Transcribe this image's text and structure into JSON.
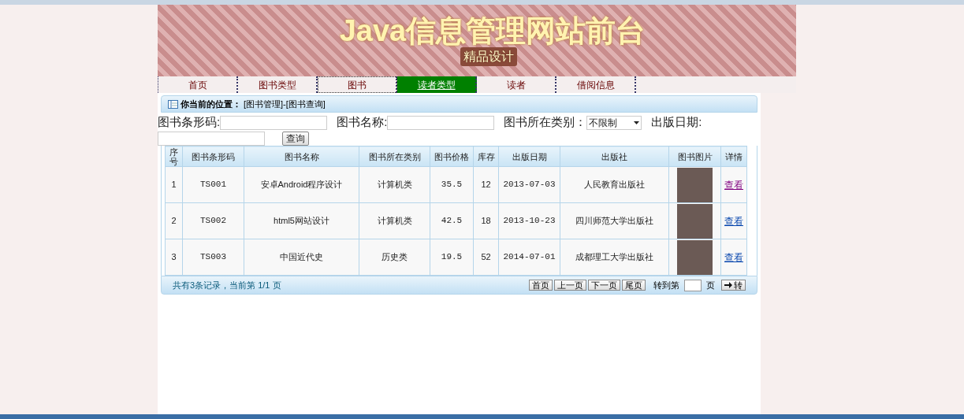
{
  "banner": {
    "title": "Java信息管理网站前台",
    "subtitle": "精品设计"
  },
  "nav": [
    {
      "label": "首页",
      "selected": false,
      "focused": false
    },
    {
      "label": "图书类型",
      "selected": false,
      "focused": false
    },
    {
      "label": "图书",
      "selected": false,
      "focused": true
    },
    {
      "label": "读者类型",
      "selected": true,
      "focused": false
    },
    {
      "label": "读者",
      "selected": false,
      "focused": false
    },
    {
      "label": "借阅信息",
      "selected": false,
      "focused": false
    }
  ],
  "breadcrumb": {
    "label": "你当前的位置：",
    "path": "[图书管理]-[图书查询]"
  },
  "search": {
    "fields": [
      {
        "kind": "input",
        "label": "图书条形码:"
      },
      {
        "kind": "input",
        "label": "图书名称:"
      },
      {
        "kind": "select",
        "label": "图书所在类别：",
        "value": "不限制"
      },
      {
        "kind": "input",
        "label": "出版日期:"
      }
    ],
    "button": "查询"
  },
  "table": {
    "columns": [
      "序号",
      "图书条形码",
      "图书名称",
      "图书所在类别",
      "图书价格",
      "库存",
      "出版日期",
      "出版社",
      "图书图片",
      "详情"
    ],
    "rows": [
      {
        "cells": [
          "1",
          "TS001",
          "安卓Android程序设计",
          "计算机类",
          "35.5",
          "12",
          "2013-07-03",
          "人民教育出版社"
        ],
        "link": "查看",
        "visited": true
      },
      {
        "cells": [
          "2",
          "TS002",
          "html5网站设计",
          "计算机类",
          "42.5",
          "18",
          "2013-10-23",
          "四川师范大学出版社"
        ],
        "link": "查看",
        "visited": false
      },
      {
        "cells": [
          "3",
          "TS003",
          "中国近代史",
          "历史类",
          "19.5",
          "52",
          "2014-07-01",
          "成都理工大学出版社"
        ],
        "link": "查看",
        "visited": false
      }
    ]
  },
  "pager": {
    "summary": "共有3条记录，当前第 1/1 页",
    "buttons": [
      "首页",
      "上一页",
      "下一页",
      "尾页"
    ],
    "goto_label": "转到第",
    "page_unit": "页",
    "go_button": "转"
  }
}
